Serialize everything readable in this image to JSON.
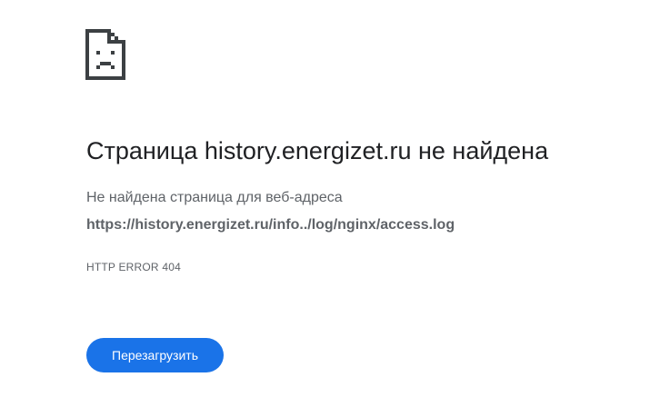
{
  "page": {
    "icon": "sad-page-icon",
    "title": "Страница history.energizet.ru не найдена",
    "subtitle": "Не найдена страница для веб-адреса",
    "url": "https://history.energizet.ru/info../log/nginx/access.log",
    "error_code": "HTTP ERROR 404",
    "reload_label": "Перезагрузить"
  },
  "colors": {
    "accent": "#1a73e8",
    "title_text": "#202124",
    "secondary_text": "#5f6368",
    "icon": "#3c4043"
  }
}
